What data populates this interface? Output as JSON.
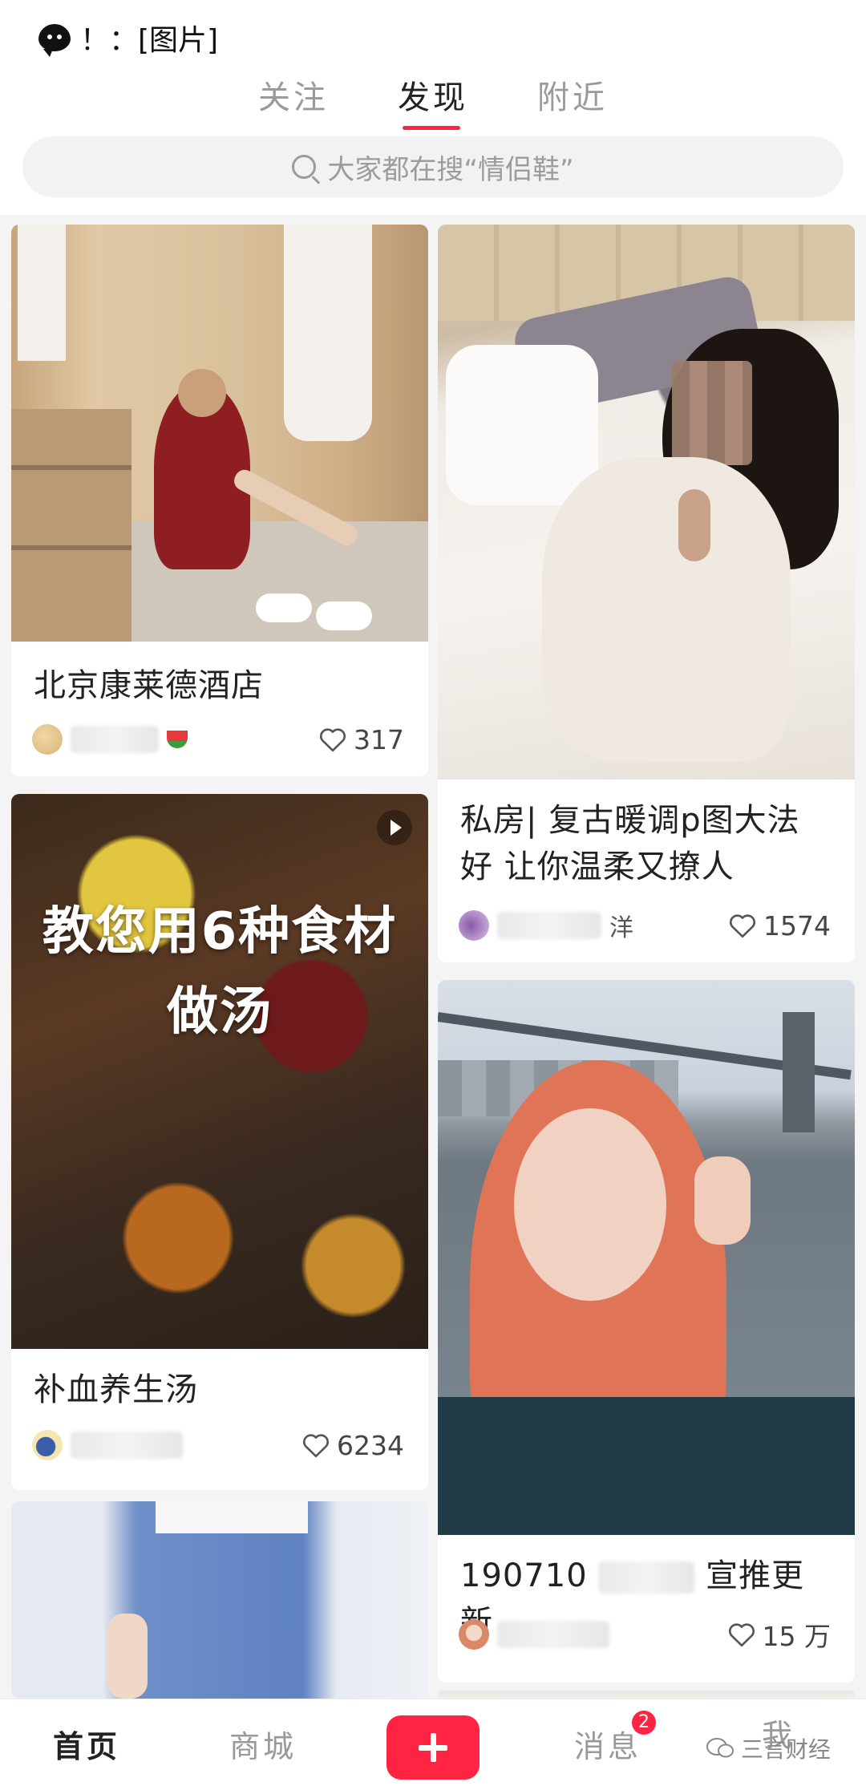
{
  "status_bar": {
    "text": "！：[图片]"
  },
  "tabs": [
    {
      "label": "关注",
      "active": false
    },
    {
      "label": "发现",
      "active": true
    },
    {
      "label": "附近",
      "active": false
    }
  ],
  "search": {
    "placeholder": "大家都在搜“情侣鞋”"
  },
  "feed": {
    "left": [
      {
        "title": "北京康莱德酒店",
        "likes": "317",
        "image": "closet-photo"
      },
      {
        "title": "补血养生汤",
        "likes": "6234",
        "image": "soup-video",
        "overlay_line1": "教您用6种食材",
        "overlay_line2": "做汤"
      },
      {
        "title": "",
        "image": "skirt-photo"
      }
    ],
    "right": [
      {
        "title_line1": "私房| 复古暖调p图大法",
        "title_line2": "好 让你温柔又撩人",
        "likes": "1574",
        "author_suffix": "洋",
        "image": "bed-photo"
      },
      {
        "title": "190710",
        "title_suffix": "宣推更新",
        "likes": "15 万",
        "image": "bridge-photo"
      }
    ]
  },
  "bottom_nav": {
    "home": "首页",
    "mall": "商城",
    "messages": "消息",
    "messages_badge": "2",
    "me": "我"
  },
  "watermark": {
    "text": "三言财经"
  },
  "colors": {
    "accent": "#ff2442",
    "text": "#222222",
    "muted": "#999999"
  }
}
